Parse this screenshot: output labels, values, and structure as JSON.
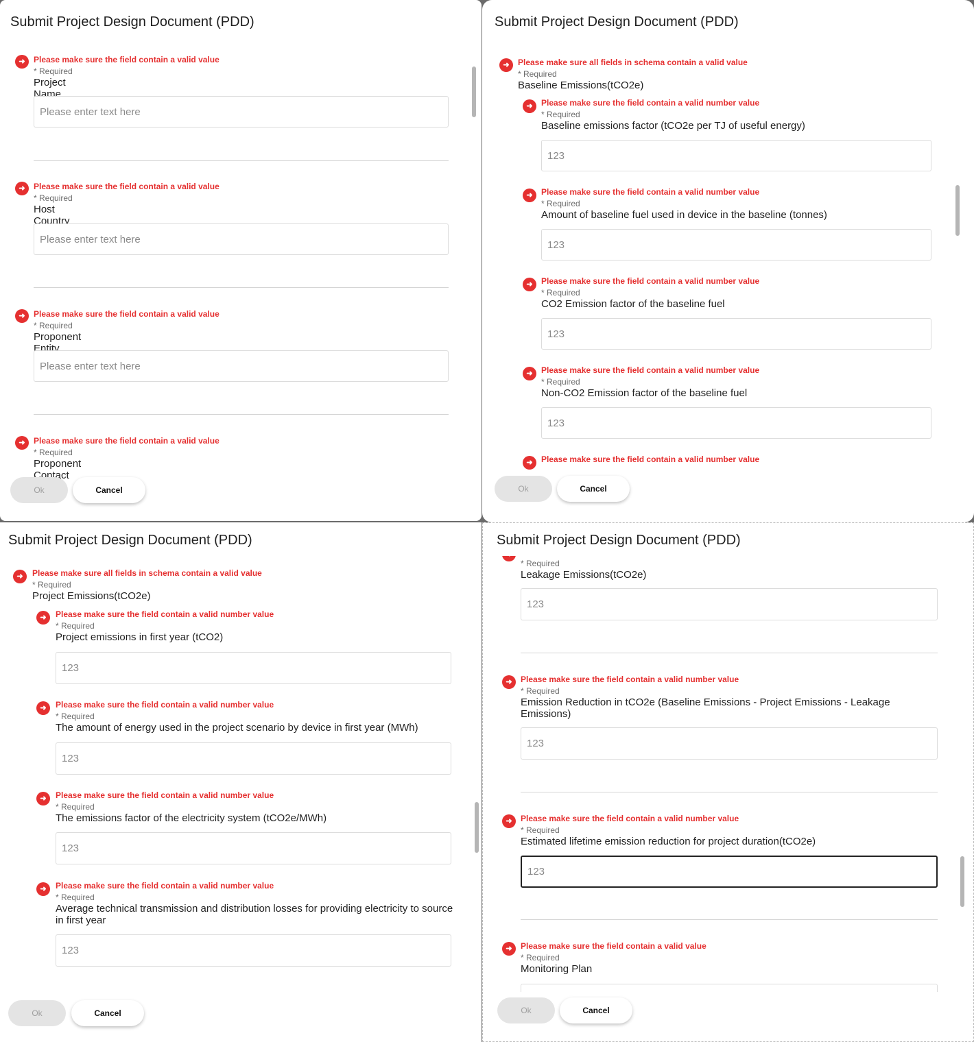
{
  "title": "Submit Project Design Document (PDD)",
  "required_label": "* Required",
  "buttons": {
    "ok": "Ok",
    "cancel": "Cancel"
  },
  "errors": {
    "valid_value": "Please make sure the field contain a valid value",
    "valid_number": "Please make sure the field contain a valid number value",
    "schema": "Please make sure all fields in schema contain a valid value"
  },
  "placeholders": {
    "text": "Please enter text here",
    "number": "123"
  },
  "panel1": {
    "fields": [
      {
        "label": "Project Name"
      },
      {
        "label": "Host Country"
      },
      {
        "label": "Proponent Entity Name"
      },
      {
        "label": "Proponent Contact"
      }
    ]
  },
  "panel2": {
    "group_label": "Baseline Emissions(tCO2e)",
    "fields": [
      {
        "label": "Baseline emissions factor (tCO2e per TJ of useful energy)"
      },
      {
        "label": "Amount of baseline fuel used in device in the baseline (tonnes)"
      },
      {
        "label": "CO2 Emission factor of the baseline fuel"
      },
      {
        "label": "Non-CO2 Emission factor of the baseline fuel"
      }
    ]
  },
  "panel3": {
    "group_label": "Project Emissions(tCO2e)",
    "fields": [
      {
        "label": "Project emissions in first year (tCO2)"
      },
      {
        "label": "The amount of energy used in the project scenario by device in first year (MWh)"
      },
      {
        "label": "The emissions factor of the electricity system (tCO2e/MWh)"
      },
      {
        "label": "Average technical transmission and distribution losses for providing electricity to source in first year"
      }
    ]
  },
  "panel4": {
    "fields": [
      {
        "label": "Leakage Emissions(tCO2e)"
      },
      {
        "label": "Emission Reduction in tCO2e (Baseline Emissions - Project Emissions - Leakage Emissions)"
      },
      {
        "label": "Estimated lifetime emission reduction for project duration(tCO2e)"
      },
      {
        "label": "Monitoring Plan"
      }
    ]
  }
}
